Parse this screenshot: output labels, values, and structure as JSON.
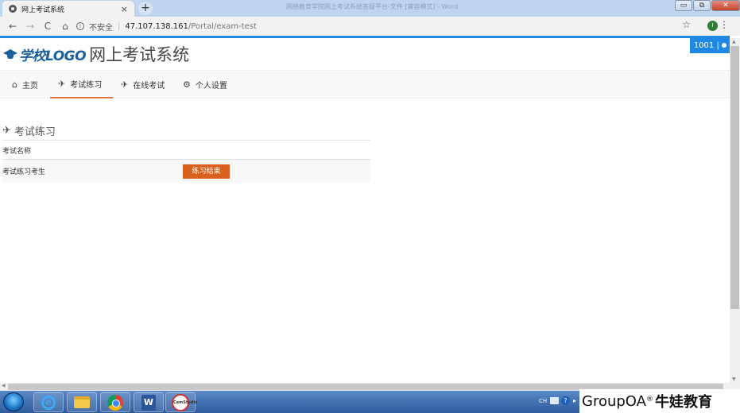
{
  "browser": {
    "tab_title": "网上考试系统",
    "tab_close": "×",
    "new_tab": "+",
    "window_title": "网络教育学院网上考试系统答疑平台-文件 [兼容模式] - Word",
    "window_buttons": {
      "minimize": "▭",
      "restore": "⧉",
      "close": "✕"
    },
    "nav": {
      "back": "←",
      "forward": "→",
      "reload": "C",
      "home": "⌂"
    },
    "security_label": "不安全",
    "url_host": "47.107.138.161",
    "url_path": "/Portal/exam-test",
    "profile_initial": "I",
    "star": "☆",
    "menu": "⋮"
  },
  "header": {
    "logo_text": "学校LOGO",
    "site_title": "网上考试系统",
    "user_badge": "1001 |"
  },
  "nav": {
    "items": [
      {
        "label": "主页",
        "icon": "home-icon",
        "glyph": "⌂"
      },
      {
        "label": "考试练习",
        "icon": "paper-plane-icon",
        "glyph": "✈"
      },
      {
        "label": "在线考试",
        "icon": "paper-plane-icon",
        "glyph": "✈"
      },
      {
        "label": "个人设置",
        "icon": "cogs-icon",
        "glyph": "⚙"
      }
    ],
    "active_index": 1
  },
  "main": {
    "section_title": "考试练习",
    "section_icon": "✈",
    "table": {
      "header": "考试名称",
      "rows": [
        {
          "name": "考试练习考生",
          "action_label": "练习结束"
        }
      ]
    }
  },
  "taskbar": {
    "lang": "CH",
    "help": "?",
    "caret": "▸",
    "ie_glyph": "e",
    "word_glyph": "W",
    "camtasia_label": "CamStudio"
  },
  "watermark": {
    "brand": "GroupOA",
    "registered": "®",
    "cn": "牛娃教育"
  },
  "colors": {
    "accent_blue": "#1e88e5",
    "nav_active_underline": "#e8733f",
    "action_button": "#d9611e",
    "logo_blue": "#1a5f9e"
  }
}
